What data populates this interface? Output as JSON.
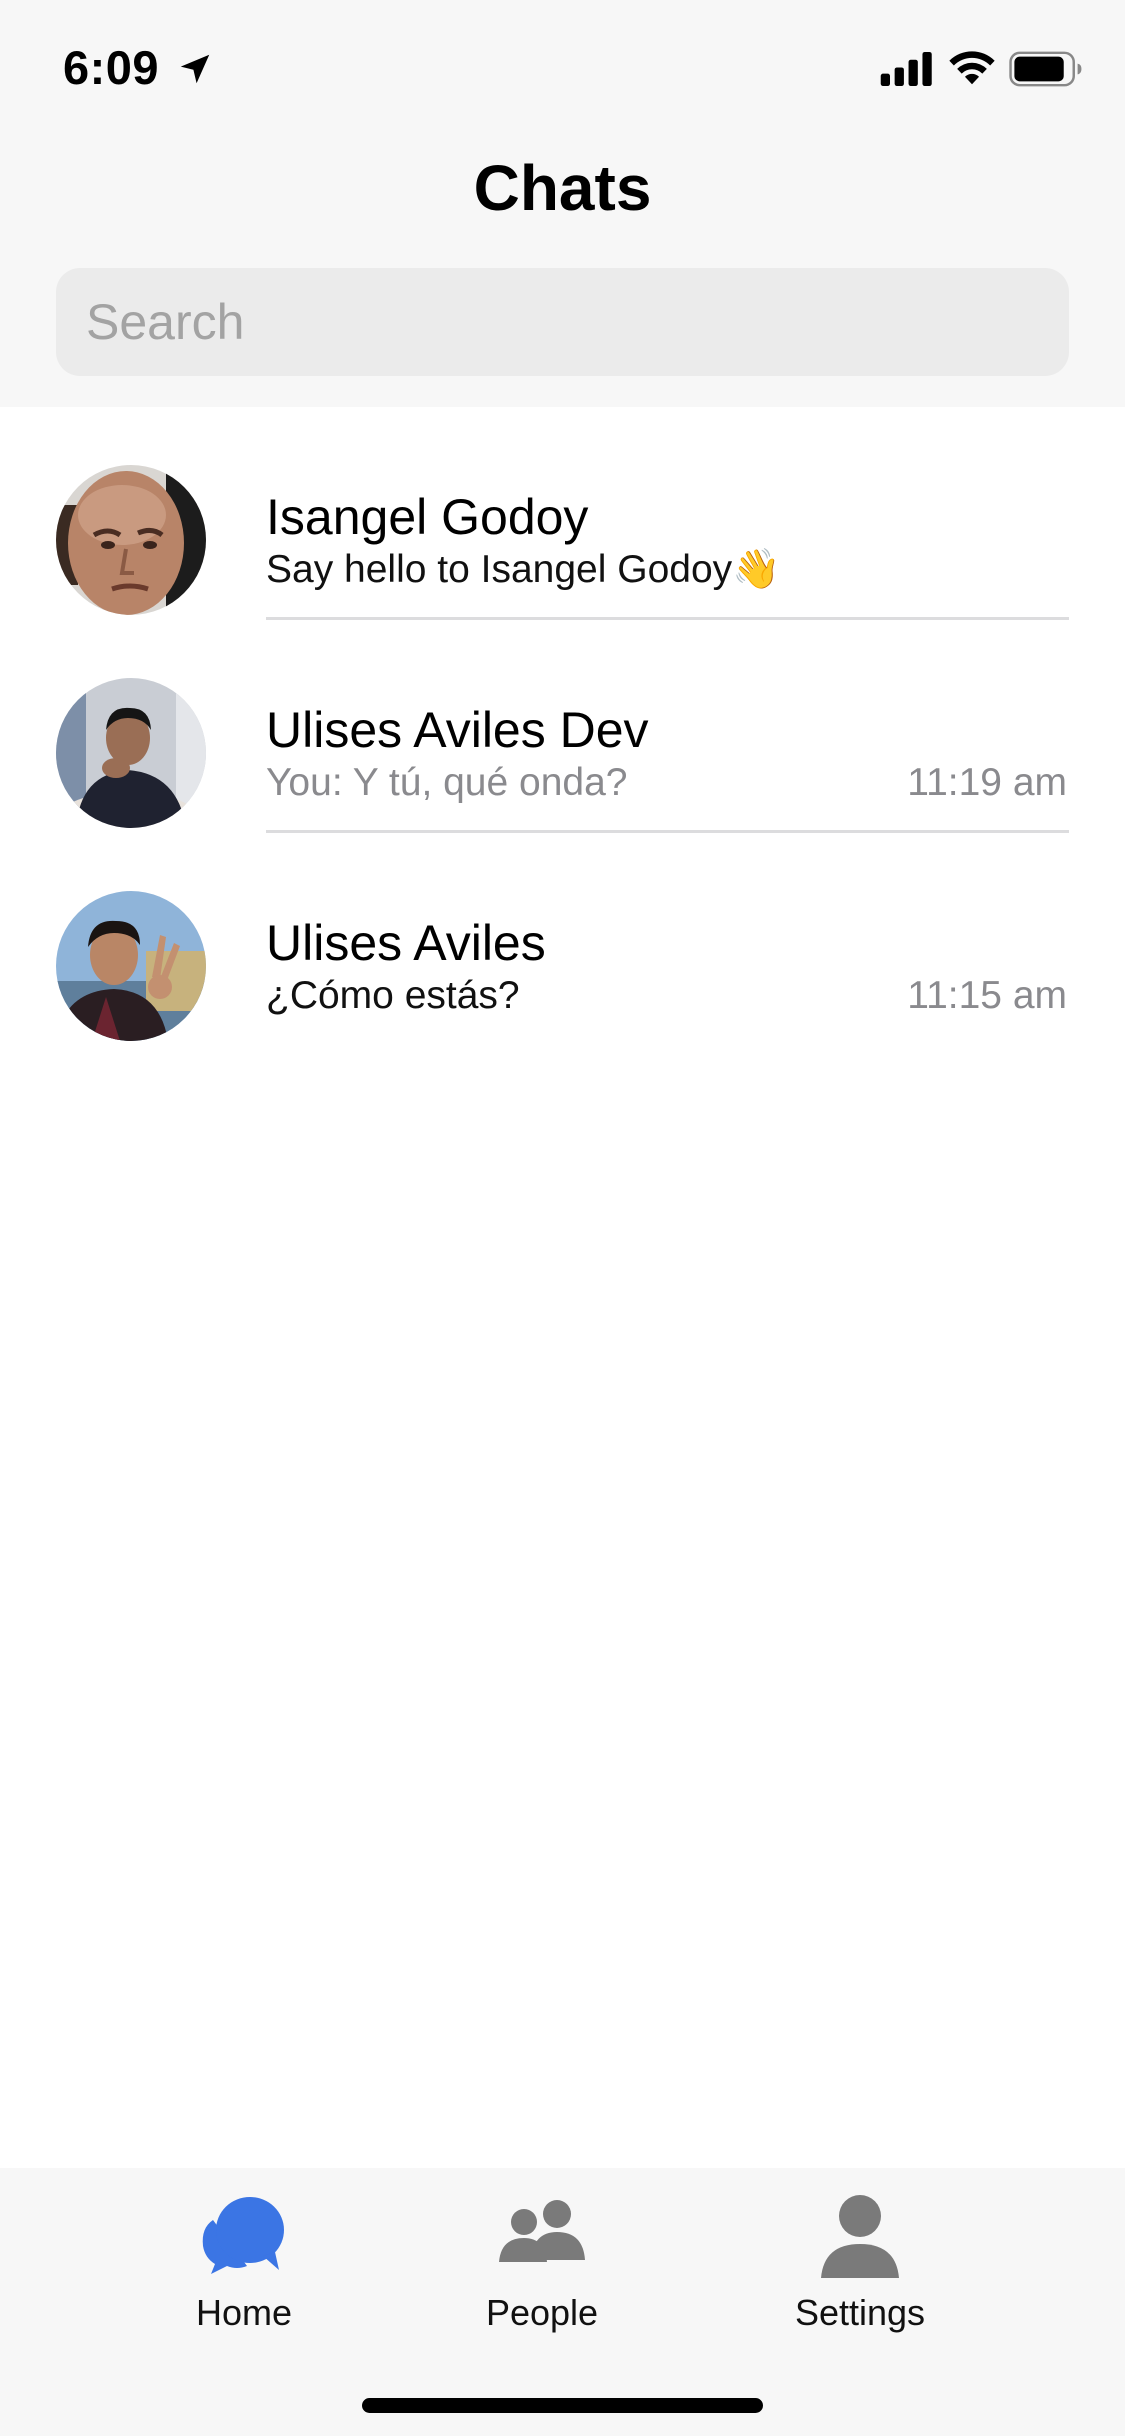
{
  "status_bar": {
    "time": "6:09",
    "icons": [
      "location-arrow-icon",
      "cellular-signal-icon",
      "wifi-icon",
      "battery-icon"
    ]
  },
  "header": {
    "title": "Chats"
  },
  "search": {
    "placeholder": "Search",
    "value": ""
  },
  "chats": [
    {
      "name": "Isangel Godoy",
      "preview": "Say hello to Isangel Godoy👋",
      "time": ""
    },
    {
      "name": "Ulises Aviles Dev",
      "preview": "You: Y tú, qué onda?",
      "time": "11:19 am"
    },
    {
      "name": "Ulises Aviles",
      "preview": "¿Cómo estás?",
      "time": "11:15 am"
    }
  ],
  "tabs": [
    {
      "label": "Home",
      "icon": "chat-bubbles-icon",
      "active": true
    },
    {
      "label": "People",
      "icon": "people-icon",
      "active": false
    },
    {
      "label": "Settings",
      "icon": "person-icon",
      "active": false
    }
  ],
  "colors": {
    "accent": "#3b75e4",
    "inactive_icon": "#7a7a7a",
    "muted_text": "#8a8a8e",
    "bar_background": "#f7f7f7"
  }
}
